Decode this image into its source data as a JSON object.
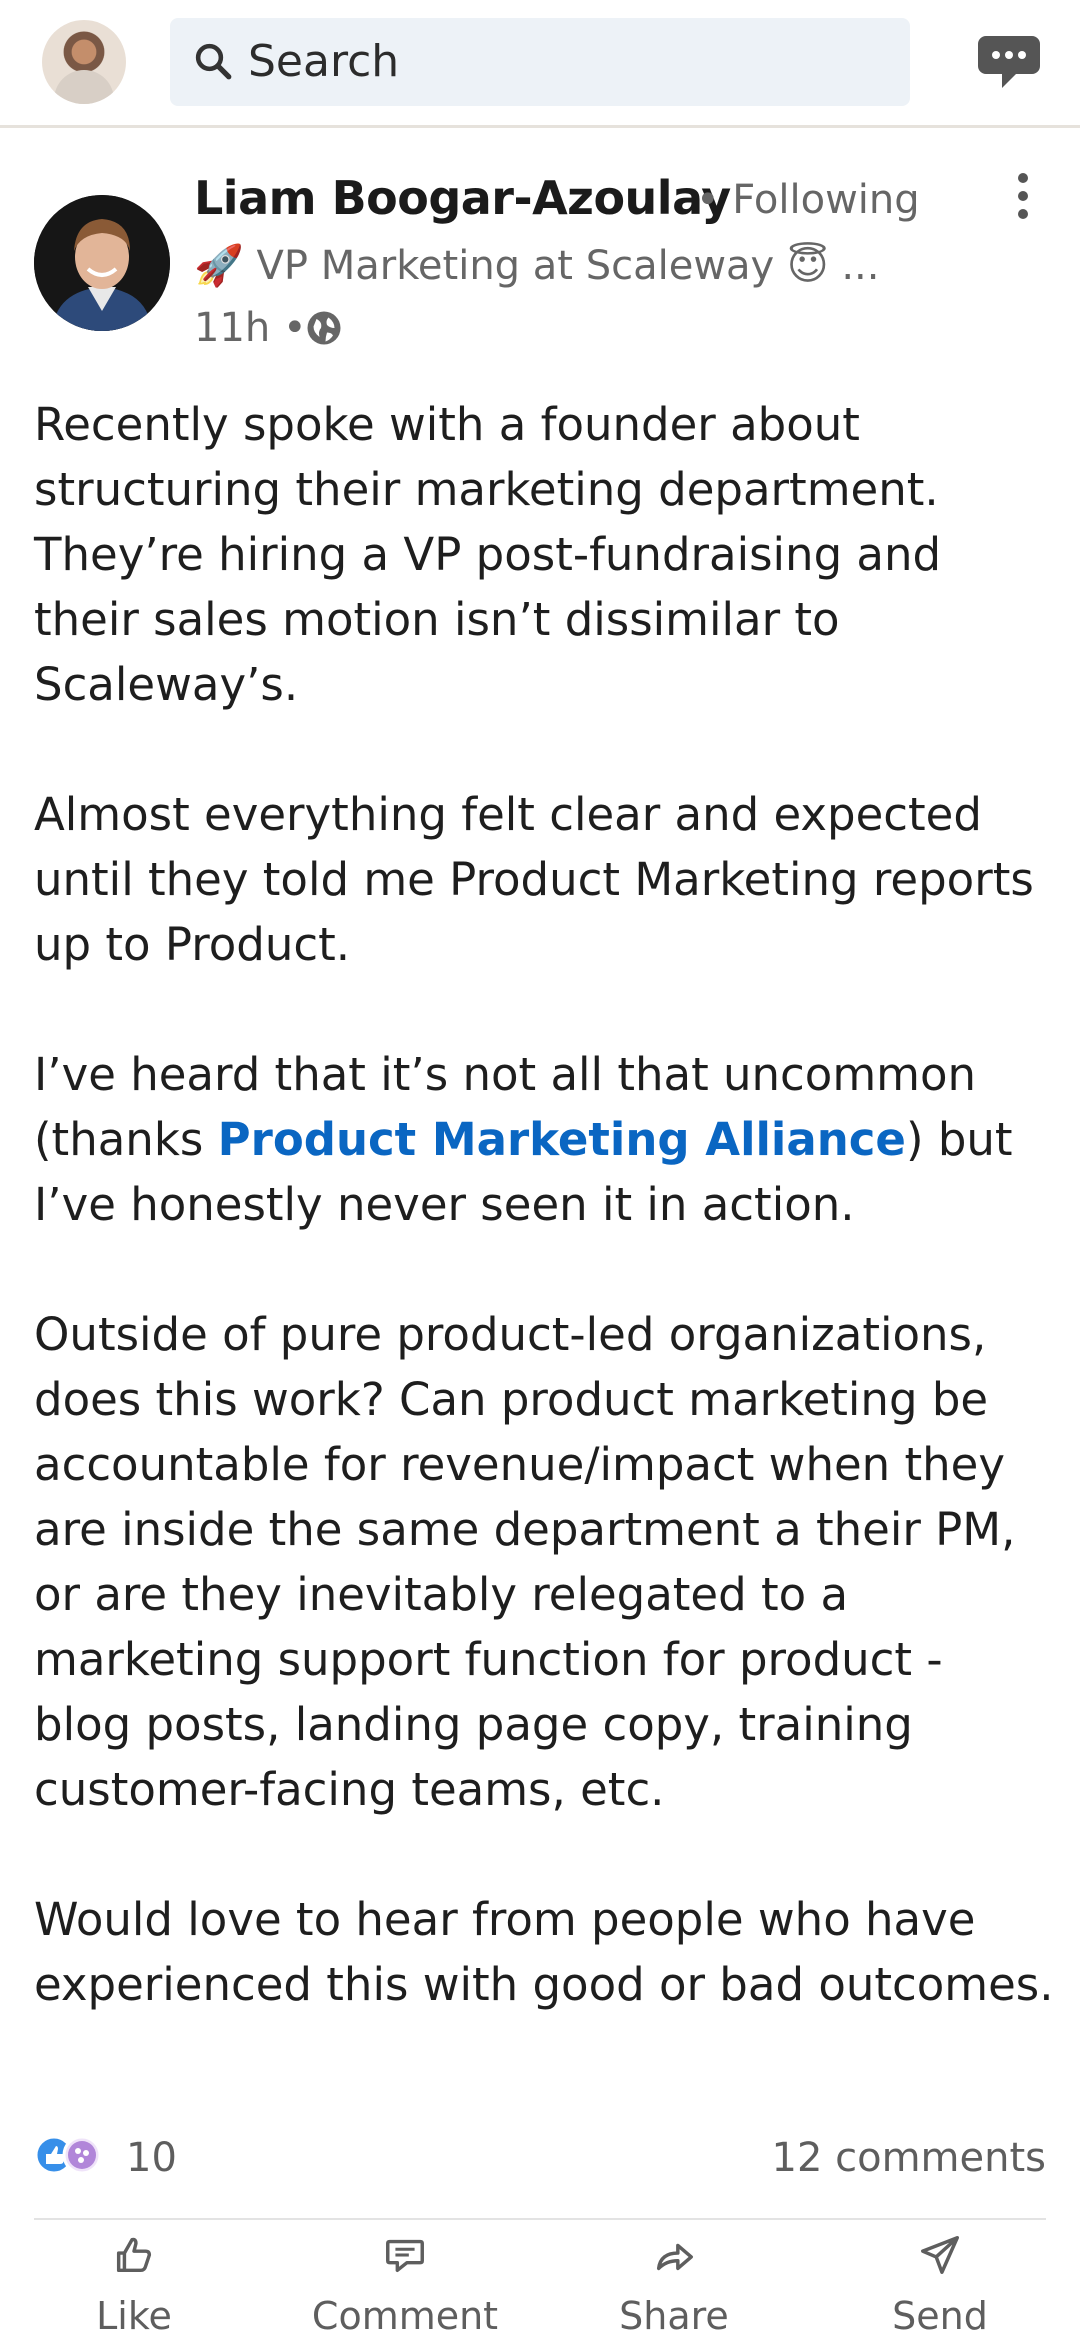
{
  "topbar": {
    "search_placeholder": "Search"
  },
  "post": {
    "author": "Liam Boogar-Azoulay",
    "following": "• Following",
    "headline": "🚀 VP Marketing at Scaleway 😇 ...",
    "time": "11h •",
    "paragraphs": [
      "Recently spoke with a founder about structuring their marketing department. They’re hiring a VP post-fundraising and their sales motion isn’t dissimilar to Scaleway’s.",
      "Almost everything felt clear and expected until they told me Product Marketing reports up to Product.",
      "Outside of pure product-led organizations, does this work? Can product marketing be accountable for revenue/impact when they are inside the same department a their PM, or are they inevitably relegated to a marketing support function for product - blog posts, landing page copy, training customer-facing teams, etc.",
      "Would love to hear from people who have experienced this with good or bad outcomes."
    ],
    "p3_before": "I’ve heard that it’s not all that uncommon (thanks ",
    "p3_mention": "Product Marketing Alliance",
    "p3_after": ") but I’ve honestly never seen it in action.",
    "reaction_count": "10",
    "comment_count": "12 comments"
  },
  "actions": {
    "like": "Like",
    "comment": "Comment",
    "share": "Share",
    "send": "Send"
  },
  "colors": {
    "link": "#0a66c2",
    "search_bg": "#edf2f7"
  }
}
